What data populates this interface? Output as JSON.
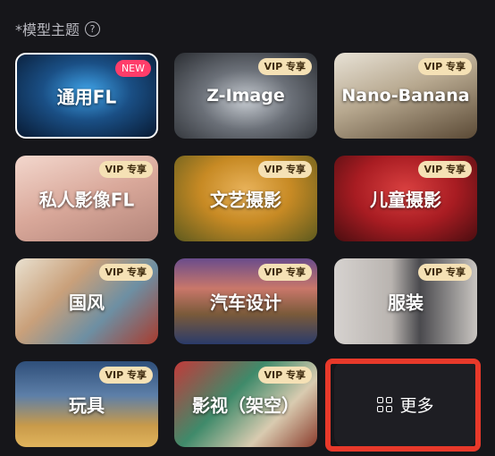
{
  "section": {
    "required_mark": "*",
    "title": "模型主题",
    "help_glyph": "?"
  },
  "cards": [
    {
      "label": "通用FL",
      "badge": "NEW"
    },
    {
      "label": "Z-Image",
      "badge": "VIP 专享"
    },
    {
      "label": "Nano-Banana",
      "badge": "VIP 专享"
    },
    {
      "label": "私人影像FL",
      "badge": "VIP 专享"
    },
    {
      "label": "文艺摄影",
      "badge": "VIP 专享"
    },
    {
      "label": "儿童摄影",
      "badge": "VIP 专享"
    },
    {
      "label": "国风",
      "badge": "VIP 专享"
    },
    {
      "label": "汽车设计",
      "badge": "VIP 专享"
    },
    {
      "label": "服装",
      "badge": "VIP 专享"
    },
    {
      "label": "玩具",
      "badge": "VIP 专享"
    },
    {
      "label": "影视（架空）",
      "badge": "VIP 专享"
    }
  ],
  "more_button": {
    "label": "更多",
    "icon": "grid-icon"
  },
  "colors": {
    "background": "#16161a",
    "vip_badge": "#f5e1b5",
    "new_badge": "#ff3d6a",
    "highlight": "#e8392a"
  }
}
